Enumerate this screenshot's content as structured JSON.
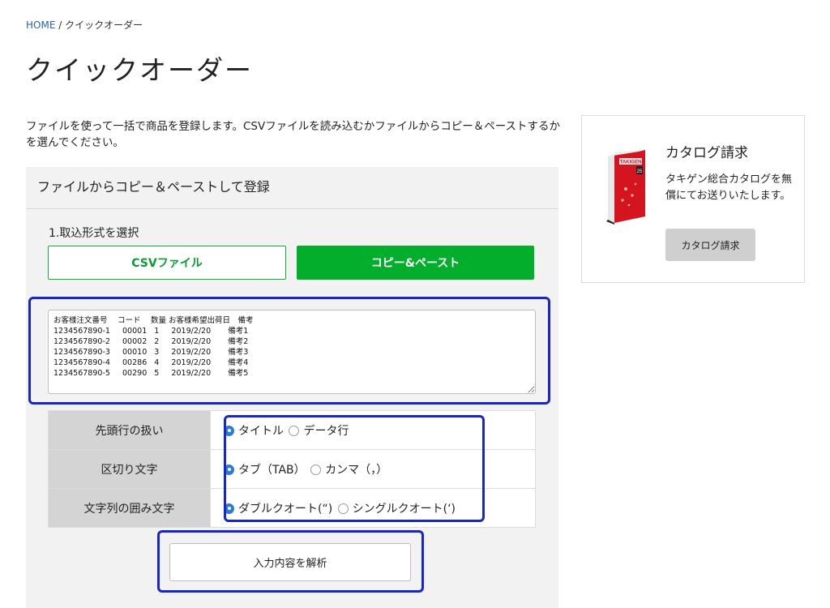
{
  "breadcrumb": {
    "home": "HOME",
    "separator": " / ",
    "current": "クイックオーダー"
  },
  "page_title": "クイックオーダー",
  "intro": "ファイルを使って一括で商品を登録します。CSVファイルを読み込むかファイルからコピー＆ペーストするかを選んでください。",
  "panel": {
    "title": "ファイルからコピー＆ペーストして登録",
    "step_label": "1.取込形式を選択",
    "csv_button": "CSVファイル",
    "paste_button": "コピー&ペースト",
    "paste_text": "お客様注文番号　 コード　 数量 お客様希望出荷日　備考\n1234567890-1     00001   1     2019/2/20       備考1\n1234567890-2     00002   2     2019/2/20       備考2\n1234567890-3     00010   3     2019/2/20       備考3\n1234567890-4     00286   4     2019/2/20       備考4\n1234567890-5     00290   5     2019/2/20       備考5",
    "options": {
      "header_row": {
        "label": "先頭行の扱い",
        "opt1": "タイトル",
        "opt2": "データ行",
        "selected": "タイトル"
      },
      "delimiter": {
        "label": "区切り文字",
        "opt1": "タブ（TAB）",
        "opt2": "カンマ（，）",
        "selected": "タブ（TAB）"
      },
      "quote": {
        "label": "文字列の囲み文字",
        "opt1": "ダブルクオート(“)",
        "opt2": "シングルクオート(‘)",
        "selected": "ダブルクオート(“)"
      }
    },
    "analyze_button": "入力内容を解析"
  },
  "catalog": {
    "title": "カタログ請求",
    "description": "タキゲン総合カタログを無償にてお送りいたします。",
    "button": "カタログ請求",
    "book_brand": "TAKIGEN",
    "book_number": "25"
  },
  "colors": {
    "accent_green": "#03ae2c",
    "highlight_blue": "#1a25c8",
    "link_blue": "#2a5fb0",
    "radio_blue": "#2b7bd6",
    "catalog_red": "#d4151f"
  }
}
